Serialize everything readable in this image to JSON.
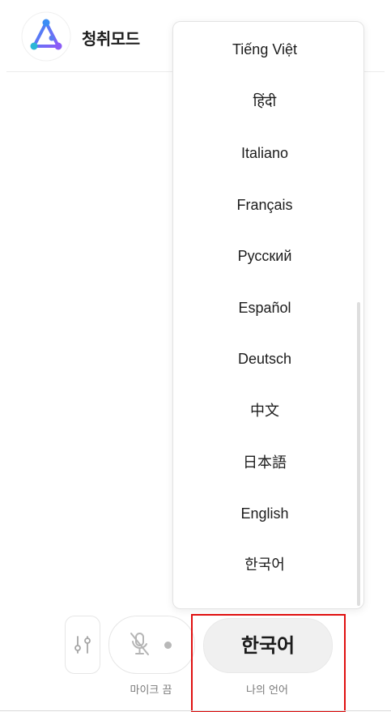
{
  "header": {
    "mode_title": "청취모드",
    "logo_icon": "triangle-network-logo"
  },
  "language_menu": {
    "items": [
      "Tiếng Việt",
      "हिंदी",
      "Italiano",
      "Français",
      "Русский",
      "Español",
      "Deutsch",
      "中文",
      "日本語",
      "English",
      "한국어"
    ]
  },
  "controls": {
    "settings_icon": "sliders-icon",
    "mic_icon": "mic-off-icon",
    "mic_label": "마이크 끔",
    "language_button": "한국어",
    "language_label": "나의 언어"
  },
  "colors": {
    "highlight": "#e01010",
    "logo_gradient_start": "#3a8df5",
    "logo_gradient_end": "#8b5cf6"
  }
}
